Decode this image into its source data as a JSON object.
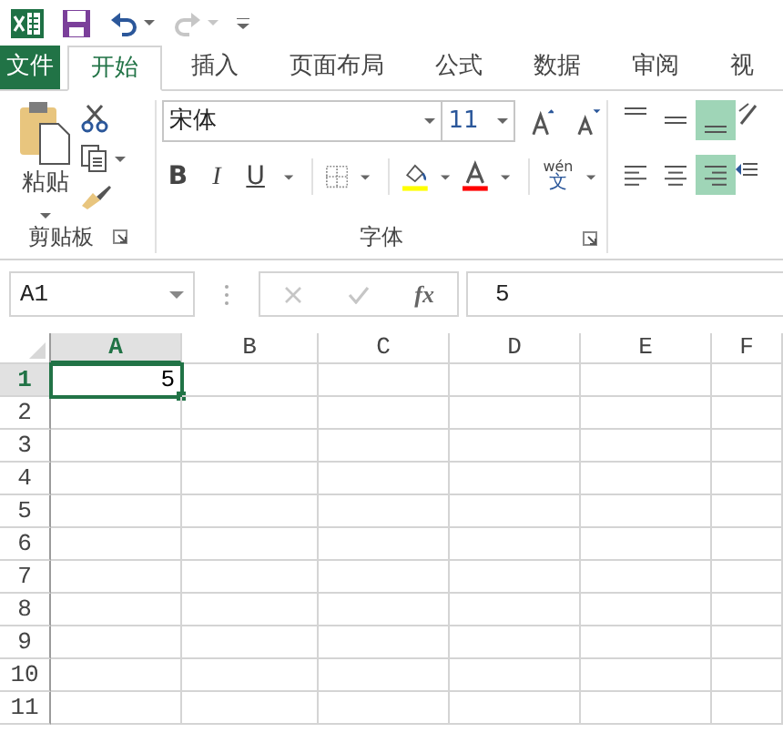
{
  "quick_access": {
    "undo": {
      "disabled": false
    },
    "redo": {
      "disabled": true
    }
  },
  "tabs": [
    {
      "label": "文件",
      "kind": "file",
      "selected": false
    },
    {
      "label": "开始",
      "kind": "tab",
      "selected": true
    },
    {
      "label": "插入",
      "kind": "tab",
      "selected": false
    },
    {
      "label": "页面布局",
      "kind": "tab",
      "selected": false
    },
    {
      "label": "公式",
      "kind": "tab",
      "selected": false
    },
    {
      "label": "数据",
      "kind": "tab",
      "selected": false
    },
    {
      "label": "审阅",
      "kind": "tab",
      "selected": false
    },
    {
      "label": "视",
      "kind": "tab",
      "selected": false
    }
  ],
  "ribbon": {
    "clipboard": {
      "label": "剪贴板",
      "paste": "粘贴"
    },
    "font": {
      "label": "字体",
      "font_name": "宋体",
      "font_size": "11",
      "bold": "B",
      "italic": "I",
      "underline": "U",
      "phonetic": "wén",
      "phonetic_char": "文"
    },
    "alignment": {
      "buttons": [
        {
          "kind": "top",
          "selected": false
        },
        {
          "kind": "middle",
          "selected": false
        },
        {
          "kind": "bottom",
          "selected": true
        },
        {
          "kind": "left",
          "selected": false
        },
        {
          "kind": "center",
          "selected": false
        },
        {
          "kind": "right",
          "selected": true
        }
      ]
    }
  },
  "formula_bar": {
    "name_box": "A1",
    "function_label": "fx",
    "formula": "5"
  },
  "grid": {
    "columns": [
      {
        "label": "A",
        "selected": true
      },
      {
        "label": "B",
        "selected": false
      },
      {
        "label": "C",
        "selected": false
      },
      {
        "label": "D",
        "selected": false
      },
      {
        "label": "E",
        "selected": false
      },
      {
        "label": "F",
        "selected": false
      }
    ],
    "rows": [
      {
        "label": "1",
        "selected": true,
        "cells": [
          {
            "value": "5",
            "selected": true
          }
        ]
      },
      {
        "label": "2",
        "selected": false
      },
      {
        "label": "3",
        "selected": false
      },
      {
        "label": "4",
        "selected": false
      },
      {
        "label": "5",
        "selected": false
      },
      {
        "label": "6",
        "selected": false
      },
      {
        "label": "7",
        "selected": false
      },
      {
        "label": "8",
        "selected": false
      },
      {
        "label": "9",
        "selected": false
      },
      {
        "label": "10",
        "selected": false
      },
      {
        "label": "11",
        "selected": false
      }
    ]
  }
}
